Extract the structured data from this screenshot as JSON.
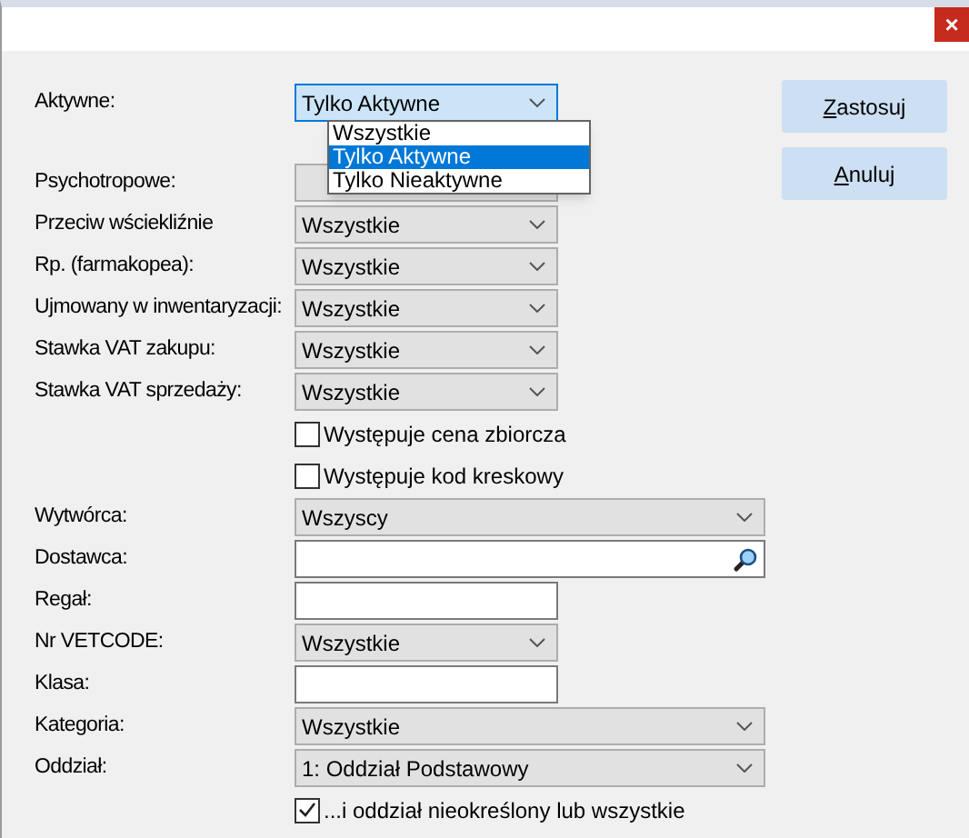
{
  "window": {
    "close": "×"
  },
  "aktywne": {
    "label": "Aktywne:",
    "value": "Tylko Aktywne",
    "expanded": true,
    "options": [
      {
        "label": "Wszystkie",
        "selected": false
      },
      {
        "label": "Tylko Aktywne",
        "selected": true
      },
      {
        "label": "Tylko Nieaktywne",
        "selected": false
      }
    ]
  },
  "buttons": [
    "Zastosuj",
    "Anuluj"
  ],
  "rows": [
    {
      "kind": "select",
      "label": "Psychotropowe:"
    },
    {
      "kind": "select",
      "label": "Przeciw wściekliźnie",
      "value": "Wszystkie"
    },
    {
      "kind": "select",
      "label": "Rp. (farmakopea):",
      "value": "Wszystkie"
    },
    {
      "kind": "select",
      "label": "Ujmowany w inwentaryzacji:",
      "value": "Wszystkie"
    },
    {
      "kind": "select",
      "label": "Stawka VAT zakupu:",
      "value": "Wszystkie"
    },
    {
      "kind": "select",
      "label": "Stawka VAT sprzedaży:",
      "value": "Wszystkie"
    },
    {
      "kind": "checkbox",
      "label": "Występuje cena zbiorcza",
      "checked": false
    },
    {
      "kind": "checkbox",
      "label": "Występuje kod kreskowy",
      "checked": false
    },
    {
      "kind": "wide_select",
      "label": "Wytwórca:",
      "value": "Wszyscy"
    },
    {
      "kind": "search",
      "label": "Dostawca:"
    },
    {
      "kind": "text",
      "label": "Regał:"
    },
    {
      "kind": "select",
      "label": "Nr VETCODE:",
      "value": "Wszystkie"
    },
    {
      "kind": "text",
      "label": "Klasa:"
    },
    {
      "kind": "wide_select",
      "label": "Kategoria:",
      "value": "Wszystkie"
    },
    {
      "kind": "wide_select",
      "label": "Oddział:",
      "value": "1: Oddział Podstawowy"
    },
    {
      "kind": "checkbox",
      "label": "...i oddział nieokreślony lub wszystkie",
      "checked": true
    }
  ]
}
